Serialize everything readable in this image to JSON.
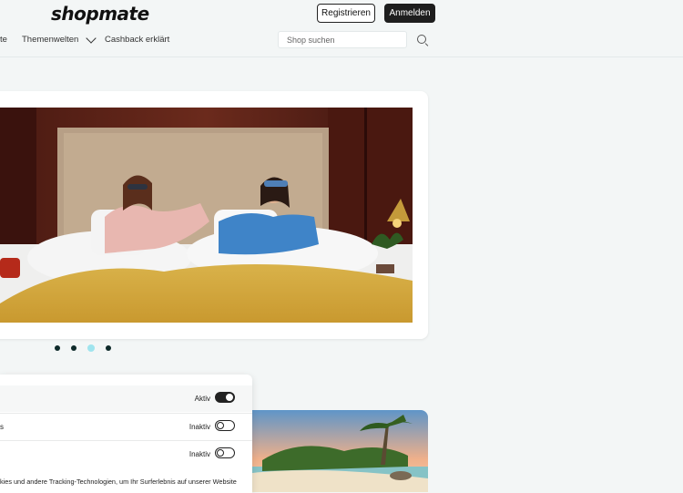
{
  "header": {
    "logo": "shopmate",
    "register_label": "Registrieren",
    "login_label": "Anmelden"
  },
  "nav": {
    "cut_item": "te",
    "themenwelten": "Themenwelten",
    "cashback": "Cashback erklärt"
  },
  "search": {
    "placeholder": "Shop suchen"
  },
  "carousel": {
    "slide_count": 4,
    "active_index": 2
  },
  "consent": {
    "rows": [
      {
        "label_cut": "",
        "state": "Aktiv",
        "on": true
      },
      {
        "label_cut": "s",
        "state": "Inaktiv",
        "on": false
      },
      {
        "label_cut": "",
        "state": "Inaktiv",
        "on": false
      }
    ],
    "text": "kies und andere Tracking-Technologien, um Ihr Surferlebnis auf unserer Website"
  },
  "colors": {
    "dark": "#1e1e1e",
    "accent": "#9fe4ee",
    "background": "#f3f6f6"
  }
}
